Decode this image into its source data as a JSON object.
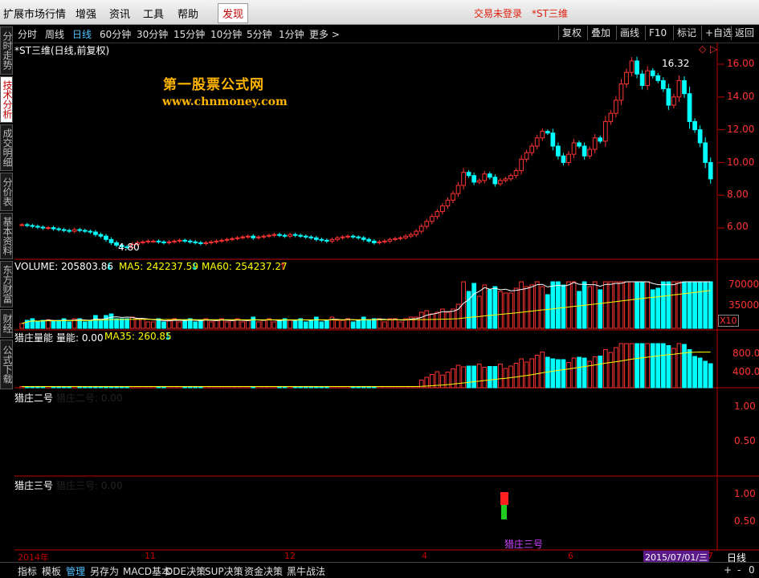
{
  "menu": {
    "items": [
      "扩展市场行情",
      "增强",
      "资讯",
      "工具",
      "帮助",
      "发现"
    ],
    "status_login": "交易未登录",
    "status_stock": "*ST三维"
  },
  "periods": [
    "分时",
    "周线",
    "日线",
    "60分钟",
    "30分钟",
    "15分钟",
    "10分钟",
    "5分钟",
    "1分钟",
    "更多 >"
  ],
  "selected_period": "日线",
  "right_tools": [
    "复权",
    "叠加",
    "画线",
    "F10",
    "标记",
    "+自选",
    "返回"
  ],
  "side_tabs": [
    "分时走势",
    "技术分析",
    "成交明细",
    "分价表",
    "基本资料",
    "东方财富",
    "财经",
    "公式下载"
  ],
  "selected_side_tab": "技术分析",
  "watermark": {
    "title": "第一股票公式网",
    "url": "www.chnmoney.com"
  },
  "main_title": "*ST三维(日线,前复权)",
  "price_annotations": {
    "high": "16.32",
    "low": "4.80"
  },
  "price_axis": [
    "16.00",
    "14.00",
    "12.00",
    "10.00",
    "8.00",
    "6.00"
  ],
  "volume": {
    "label": "VOLUME: 205803.86",
    "ma5": "MA5: 242237.59",
    "ma60": "MA60: 254237.27",
    "axis": [
      "70000",
      "35000"
    ],
    "unit": "X10"
  },
  "liecang": {
    "title": "猎庄量能",
    "value": "量能: 0.00",
    "ma35": "MA35: 260.85",
    "axis": [
      "800.0",
      "400.0"
    ]
  },
  "liezhuang2": {
    "title": "猎庄二号",
    "value": "猎庄二号: 0.00",
    "axis": [
      "1.00",
      "0.50"
    ]
  },
  "liezhuang3": {
    "title": "猎庄三号",
    "value": "猎庄三号: 0.00",
    "axis": [
      "1.00",
      "0.50"
    ],
    "signal_label": "猎庄三号"
  },
  "date_bar": {
    "labels": [
      "2014年",
      "11",
      "12",
      "4",
      "6",
      "7"
    ],
    "cursor_date": "2015/07/01/三",
    "period": "日线"
  },
  "bottom_tabs": [
    "指标",
    "模板",
    "管理",
    "另存为",
    "MACD基本",
    "DDE决策",
    "SUP决策",
    "资金决策",
    "黑牛战法"
  ],
  "selected_bottom_tab": "管理",
  "bottom_right": [
    "+",
    "-",
    "0"
  ],
  "colors": {
    "up": "#ff3333",
    "down": "#00ffff",
    "ma_white": "#ffffff",
    "ma_yellow": "#ffff00",
    "axis_red": "#c00000",
    "watermark": "#ffb400"
  },
  "chart_data": {
    "type": "candlestick",
    "closes": [
      6.2,
      6.15,
      6.1,
      6.05,
      6.0,
      6.02,
      5.95,
      5.9,
      5.85,
      5.8,
      5.9,
      5.85,
      5.8,
      5.75,
      5.6,
      5.5,
      5.3,
      5.1,
      4.95,
      4.85,
      4.8,
      5.0,
      5.1,
      5.15,
      5.2,
      5.2,
      5.15,
      5.1,
      5.15,
      5.2,
      5.25,
      5.2,
      5.15,
      5.1,
      5.05,
      5.1,
      5.15,
      5.2,
      5.25,
      5.3,
      5.35,
      5.4,
      5.45,
      5.5,
      5.4,
      5.45,
      5.5,
      5.55,
      5.6,
      5.55,
      5.5,
      5.6,
      5.55,
      5.5,
      5.45,
      5.4,
      5.3,
      5.25,
      5.2,
      5.3,
      5.4,
      5.45,
      5.5,
      5.45,
      5.4,
      5.3,
      5.2,
      5.1,
      5.15,
      5.2,
      5.3,
      5.35,
      5.4,
      5.5,
      5.6,
      5.8,
      6.1,
      6.4,
      6.7,
      7.0,
      7.35,
      7.7,
      8.1,
      8.6,
      9.4,
      9.2,
      8.8,
      8.9,
      9.3,
      9.1,
      8.7,
      8.9,
      9.0,
      9.2,
      9.5,
      10.2,
      10.6,
      11.0,
      11.5,
      11.9,
      11.8,
      11.0,
      10.4,
      10.0,
      10.5,
      11.2,
      11.0,
      10.4,
      10.8,
      11.5,
      11.3,
      12.5,
      13.0,
      13.8,
      14.8,
      15.5,
      16.2,
      15.4,
      14.7,
      15.6,
      15.3,
      15.0,
      14.5,
      13.5,
      14.0,
      15.0,
      14.2,
      12.5,
      12.0,
      11.2,
      10.0,
      9.0
    ]
  }
}
